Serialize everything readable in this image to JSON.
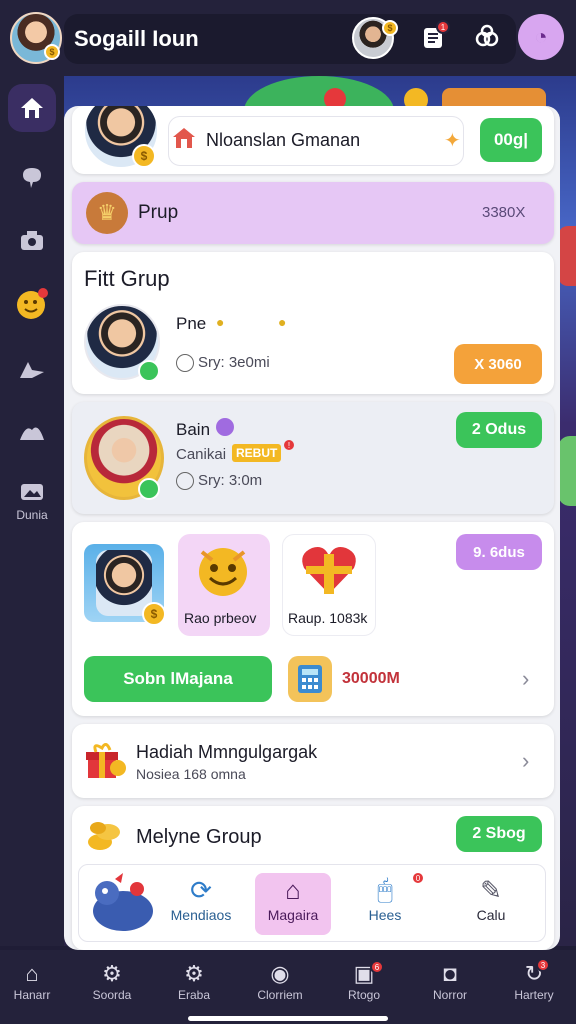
{
  "header": {
    "title": "Sogaill Ioun",
    "icons": [
      "avatar",
      "clipboard-icon",
      "link-icon",
      "profile-icon"
    ]
  },
  "left_rail": {
    "items": [
      "home-icon",
      "chat-icon",
      "camera-icon",
      "emoji-icon",
      "bird-icon",
      "leaf-icon",
      "image-icon"
    ],
    "label": "Dunia"
  },
  "card_top": {
    "label": "Nloanslan Gmanan",
    "button": "00g|"
  },
  "card_prup": {
    "label": "Prup",
    "value": "3380X"
  },
  "card_fitt": {
    "title": "Fitt Grup",
    "name": "Pne",
    "status": "Sry: 3e0mi",
    "button": "X 3060"
  },
  "card_bain": {
    "name": "Bain",
    "sub": "Canikai",
    "badge": "REBUT",
    "status": "Sry: 3:0m",
    "button": "2 Odus"
  },
  "card_gift": {
    "button_top": "9. 6dus",
    "item1": "Rao prbeov",
    "item2": "Raup. 1083k",
    "action": "Sobn lMajana",
    "amount": "30000M"
  },
  "card_hadiah": {
    "title": "Hadiah Mmngulgargak",
    "sub": "Nosiea 168 omna"
  },
  "card_melyne": {
    "title": "Melyne Group",
    "button": "2 Sbog"
  },
  "dock": {
    "items": [
      {
        "label": "",
        "icon": "creature-icon"
      },
      {
        "label": "Mendiaos",
        "icon": "refresh-icon"
      },
      {
        "label": "Magaira",
        "icon": "home-icon"
      },
      {
        "label": "Hees",
        "icon": "mouse-icon"
      },
      {
        "label": "Calu",
        "icon": "pen-icon"
      }
    ]
  },
  "bottom_nav": {
    "items": [
      {
        "label": "Hanarr",
        "icon": "home-icon"
      },
      {
        "label": "Soorda",
        "icon": "gear-icon"
      },
      {
        "label": "Eraba",
        "icon": "gear-icon"
      },
      {
        "label": "Clorriem",
        "icon": "camera-icon"
      },
      {
        "label": "Rtogo",
        "icon": "cart-icon"
      },
      {
        "label": "Norror",
        "icon": "camera-icon"
      },
      {
        "label": "Hartery",
        "icon": "refresh-icon"
      }
    ]
  },
  "colors": {
    "accent_green": "#3bc45a",
    "accent_purple": "#c78cec",
    "accent_orange": "#f4a23a",
    "bar_dark": "#24223b"
  }
}
